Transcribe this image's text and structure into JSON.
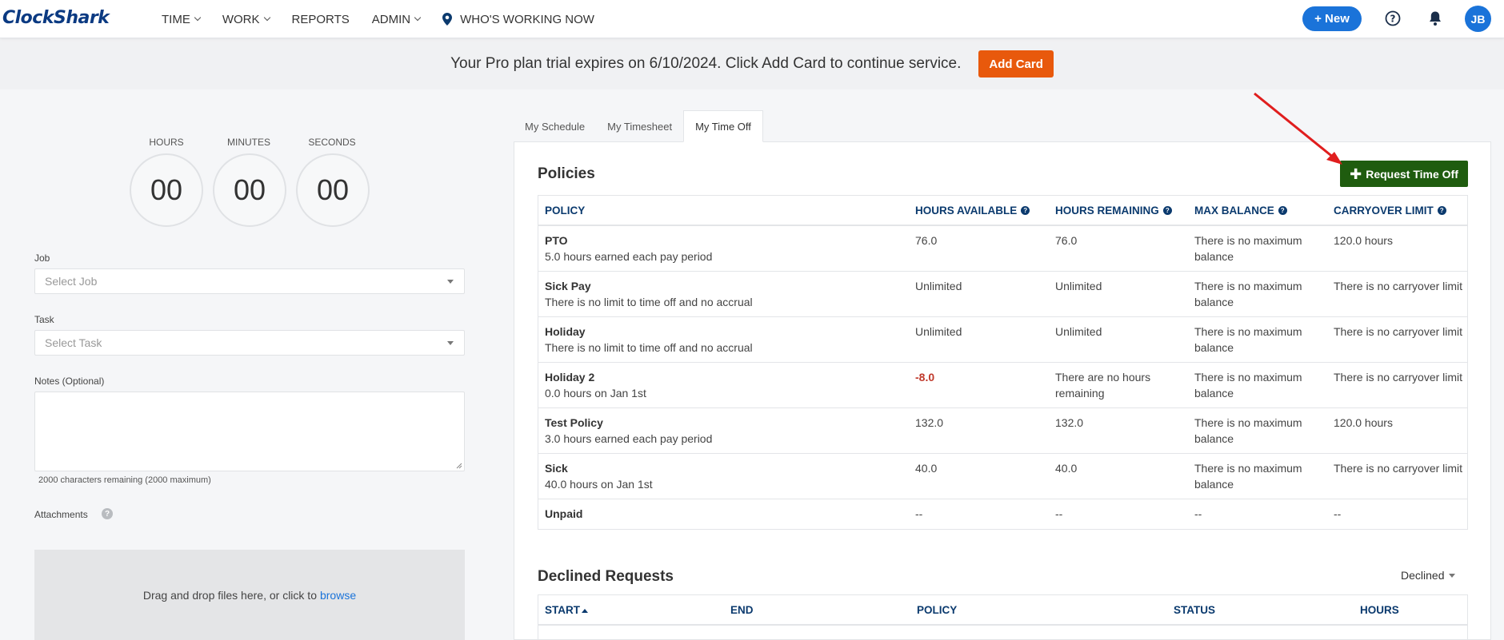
{
  "header": {
    "logo": "ClockShark",
    "nav": [
      {
        "label": "TIME",
        "dropdown": true
      },
      {
        "label": "WORK",
        "dropdown": true
      },
      {
        "label": "REPORTS",
        "dropdown": false
      },
      {
        "label": "ADMIN",
        "dropdown": true
      },
      {
        "label": "WHO'S WORKING NOW",
        "dropdown": false,
        "icon": "location-pin-icon"
      }
    ],
    "new_button": "+ New",
    "avatar_initials": "JB",
    "icons": [
      "help-icon",
      "bell-icon"
    ]
  },
  "banner": {
    "text": "Your Pro plan trial expires on 6/10/2024. Click Add Card to continue service.",
    "button": "Add Card"
  },
  "timer": {
    "hours_label": "HOURS",
    "minutes_label": "MINUTES",
    "seconds_label": "SECONDS",
    "hours": "00",
    "minutes": "00",
    "seconds": "00"
  },
  "form": {
    "job_label": "Job",
    "job_placeholder": "Select Job",
    "task_label": "Task",
    "task_placeholder": "Select Task",
    "notes_label": "Notes (Optional)",
    "chars_remaining": "2000 characters remaining (2000 maximum)",
    "attachments_label": "Attachments",
    "dropzone_text": "Drag and drop files here, or click to",
    "dropzone_link": "browse"
  },
  "tabs": [
    "My Schedule",
    "My Timesheet",
    "My Time Off"
  ],
  "active_tab": "My Time Off",
  "policies": {
    "title": "Policies",
    "request_button": "Request Time Off",
    "columns": [
      "POLICY",
      "HOURS AVAILABLE",
      "HOURS REMAINING",
      "MAX BALANCE",
      "CARRYOVER LIMIT"
    ],
    "rows": [
      {
        "name": "PTO",
        "desc": "5.0 hours earned each pay period",
        "available": "76.0",
        "remaining": "76.0",
        "max": "There is no maximum balance",
        "carryover": "120.0 hours"
      },
      {
        "name": "Sick Pay",
        "desc": "There is no limit to time off and no accrual",
        "available": "Unlimited",
        "remaining": "Unlimited",
        "max": "There is no maximum balance",
        "carryover": "There is no carryover limit"
      },
      {
        "name": "Holiday",
        "desc": "There is no limit to time off and no accrual",
        "available": "Unlimited",
        "remaining": "Unlimited",
        "max": "There is no maximum balance",
        "carryover": "There is no carryover limit"
      },
      {
        "name": "Holiday 2",
        "desc": "0.0 hours on Jan 1st",
        "available": "-8.0",
        "remaining": "There are no hours remaining",
        "max": "There is no maximum balance",
        "carryover": "There is no carryover limit",
        "negative": true
      },
      {
        "name": "Test Policy",
        "desc": "3.0 hours earned each pay period",
        "available": "132.0",
        "remaining": "132.0",
        "max": "There is no maximum balance",
        "carryover": "120.0 hours"
      },
      {
        "name": "Sick",
        "desc": "40.0 hours on Jan 1st",
        "available": "40.0",
        "remaining": "40.0",
        "max": "There is no maximum balance",
        "carryover": "There is no carryover limit"
      },
      {
        "name": "Unpaid",
        "desc": "",
        "available": "--",
        "remaining": "--",
        "max": "--",
        "carryover": "--"
      }
    ]
  },
  "declined": {
    "title": "Declined Requests",
    "filter": "Declined",
    "columns": [
      "START",
      "END",
      "POLICY",
      "STATUS",
      "HOURS"
    ]
  },
  "colors": {
    "brand_blue": "#0b3a82",
    "primary": "#1a73d9",
    "orange": "#e8590c",
    "green_button": "#1f5c0f",
    "negative": "#c0392b",
    "annotation_arrow": "#e01e1e"
  }
}
